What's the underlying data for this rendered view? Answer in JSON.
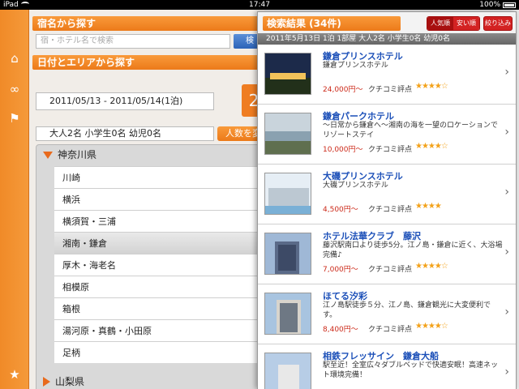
{
  "status": {
    "carrier": "iPad",
    "time": "17:47",
    "battery": "100%"
  },
  "search": {
    "header": "宿名から探す",
    "placeholder": "宿・ホテル名で検索",
    "button_label": "検"
  },
  "date_area": {
    "header": "日付とエリアから探す",
    "date_range": "2011/05/13 - 2011/05/14(1泊)",
    "calendar_glyph": "2"
  },
  "people": {
    "summary": "大人2名 小学生0名 幼児0名",
    "change_button": "人数を変更"
  },
  "regions": {
    "expanded_pref": "神奈川県",
    "collapsed_pref": "山梨県",
    "areas": [
      "川崎",
      "横浜",
      "横須賀・三浦",
      "湘南・鎌倉",
      "厚木・海老名",
      "相模原",
      "箱根",
      "湯河原・真鶴・小田原",
      "足柄"
    ],
    "selected_index": 3
  },
  "results": {
    "title": "検索結果 (34件)",
    "sort_popular": "人気順",
    "sort_cheap": "安い順",
    "filter": "絞り込み",
    "condition": "2011年5月13日 1泊 1部屋 大人2名 小学生0名 幼児0名",
    "items": [
      {
        "name": "鎌倉プリンスホテル",
        "desc": "鎌倉プリンスホテル",
        "price": "24,000円〜",
        "review_label": "クチコミ評点",
        "rating": 4.5
      },
      {
        "name": "鎌倉パークホテル",
        "desc": "～日常から鎌倉へ～湘南の海を一望のロケーションでリゾートステイ",
        "price": "10,000円〜",
        "review_label": "クチコミ評点",
        "rating": 4.5
      },
      {
        "name": "大磯プリンスホテル",
        "desc": "大磯プリンスホテル",
        "price": "4,500円〜",
        "review_label": "クチコミ評点",
        "rating": 4
      },
      {
        "name": "ホテル法華クラブ　藤沢",
        "desc": "藤沢駅南口より徒歩5分。江ノ島・鎌倉に近く、大浴場完備♪",
        "price": "7,000円〜",
        "review_label": "クチコミ評点",
        "rating": 4.5
      },
      {
        "name": "ほてる汐彩",
        "desc": "江ノ島駅徒歩５分、江ノ島、鎌倉観光に大変便利です。",
        "price": "8,400円〜",
        "review_label": "クチコミ評点",
        "rating": 4.5
      },
      {
        "name": "相鉄フレッサイン　鎌倉大船",
        "desc": "駅至近！全室広々ダブルベッドで快適安眠！高速ネット環境完備！",
        "price": "",
        "review_label": "",
        "rating": 0
      }
    ]
  },
  "rail_icons": [
    "home-icon",
    "binoculars-icon",
    "flag-icon",
    "star-icon"
  ],
  "colors": {
    "accent": "#ec7a19",
    "link": "#1b4fb8",
    "price": "#cc2a1a",
    "sort_red": "#d32222"
  }
}
